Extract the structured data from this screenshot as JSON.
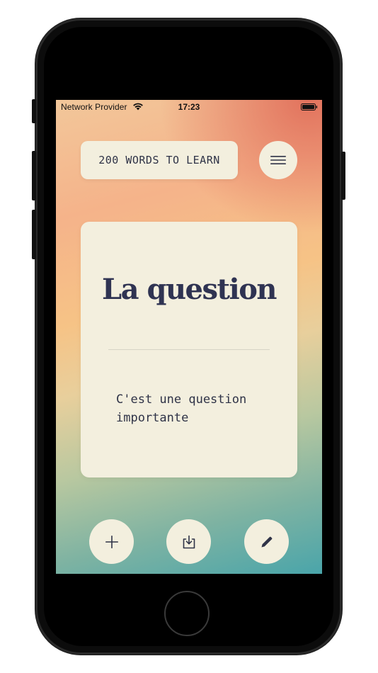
{
  "status_bar": {
    "carrier": "Network Provider",
    "time": "17:23",
    "wifi_icon": "wifi-icon",
    "battery_icon": "battery-icon"
  },
  "header": {
    "title": "200 WORDS TO LEARN",
    "menu_icon": "hamburger-menu-icon"
  },
  "card": {
    "word": "La question",
    "example": "C'est une question importante"
  },
  "actions": {
    "add_icon": "plus-icon",
    "save_icon": "download-icon",
    "edit_icon": "pencil-icon"
  },
  "colors": {
    "card_background": "#f3efde",
    "text_primary": "#2f3352",
    "gradient_top": "#f2c79a",
    "gradient_accent": "#e16e5a",
    "gradient_bottom": "#4aa5aa"
  }
}
